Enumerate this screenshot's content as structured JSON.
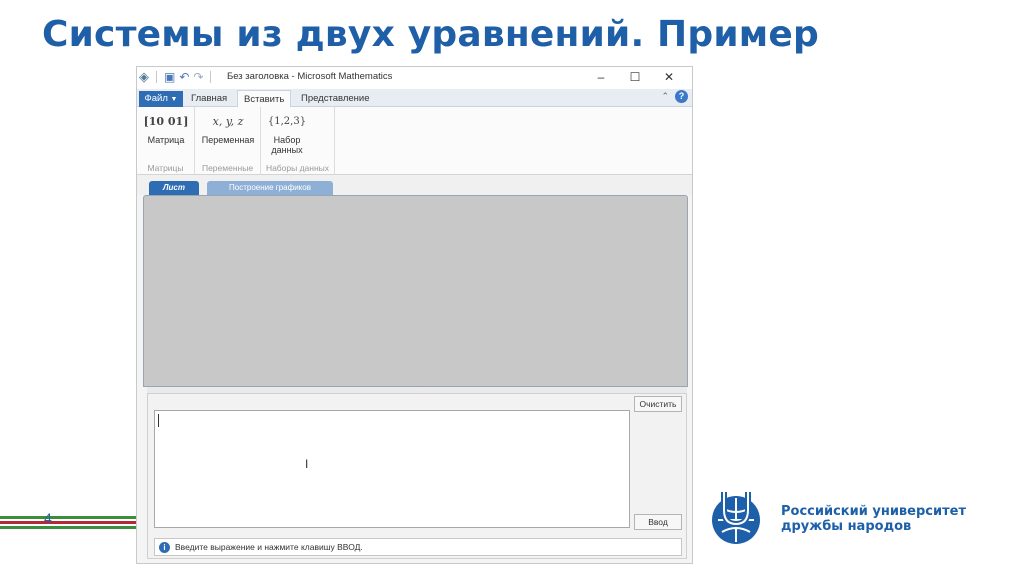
{
  "slide": {
    "title": "Системы из двух уравнений. Пример",
    "page_number": "4"
  },
  "window": {
    "title": "Без заголовка - Microsoft Mathematics",
    "controls": {
      "minimize": "–",
      "maximize": "☐",
      "close": "✕"
    }
  },
  "quick_access": {
    "logo_icon": "app-logo-icon",
    "save_icon": "save-icon",
    "undo_icon": "undo-icon",
    "redo_icon": "redo-icon"
  },
  "ribbon_tabs": {
    "file": "Файл",
    "items": [
      "Главная",
      "Вставить",
      "Представление"
    ],
    "active": "Вставить"
  },
  "ribbon": {
    "groups": [
      {
        "label": "Матрицы",
        "button": {
          "icon_text": "[10 01]",
          "label": "Матрица"
        }
      },
      {
        "label": "Переменные",
        "button": {
          "icon_text": "x, y, z",
          "label": "Переменная"
        }
      },
      {
        "label": "Наборы данных",
        "button": {
          "icon_text": "{1,2,3}",
          "label_line1": "Набор",
          "label_line2": "данных"
        }
      }
    ]
  },
  "doc_tabs": {
    "active": "Лист",
    "inactive": "Построение графиков"
  },
  "input": {
    "clear_button": "Очистить",
    "enter_button": "Ввод",
    "status_text": "Введите выражение и нажмите клавишу ВВОД."
  },
  "branding": {
    "university_line1": "Российский университет",
    "university_line2": "дружбы народов",
    "colors": {
      "title_blue": "#1f5fa8",
      "accent_blue": "#2e6db4",
      "stripe_green": "#3a8f3a",
      "stripe_red": "#b3293a"
    }
  }
}
